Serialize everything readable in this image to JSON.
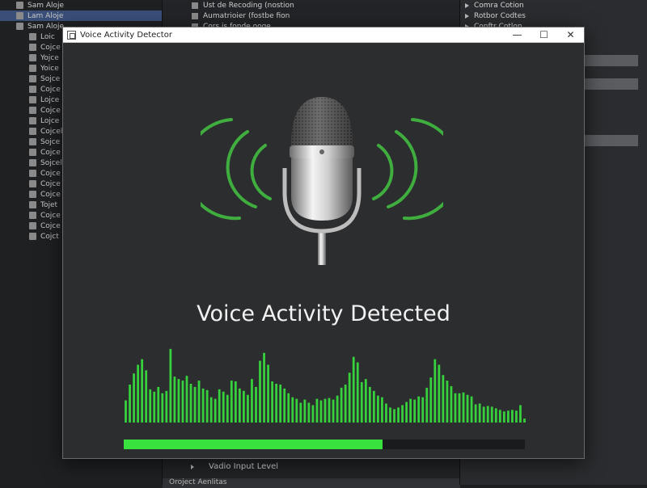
{
  "background": {
    "left_panel": [
      {
        "label": "Sam Aloje",
        "top": true,
        "selected": false
      },
      {
        "label": "Lam Aloje",
        "top": true,
        "selected": true
      },
      {
        "label": "Sam Aloje",
        "top": true,
        "selected": false
      },
      {
        "label": "Loic",
        "selected": false
      },
      {
        "label": "Cojce",
        "selected": false
      },
      {
        "label": "Yojce",
        "selected": false
      },
      {
        "label": "Yoice",
        "selected": false
      },
      {
        "label": "Sojce",
        "selected": false
      },
      {
        "label": "Cojce",
        "selected": false
      },
      {
        "label": "Lojce",
        "selected": false
      },
      {
        "label": "Cojce",
        "selected": false
      },
      {
        "label": "Lojce",
        "selected": false
      },
      {
        "label": "Cojcel",
        "selected": false
      },
      {
        "label": "Sojce",
        "selected": false
      },
      {
        "label": "Cojce",
        "selected": false
      },
      {
        "label": "Sojcel",
        "selected": false
      },
      {
        "label": "Cojce",
        "selected": false
      },
      {
        "label": "Cojce",
        "selected": false
      },
      {
        "label": "Cojce",
        "selected": false
      },
      {
        "label": "Tojet",
        "selected": false
      },
      {
        "label": "Cojce",
        "selected": false
      },
      {
        "label": "Cojce",
        "selected": false
      },
      {
        "label": "Cojct",
        "selected": false
      }
    ],
    "middle_panel": [
      "Ust de Recoding (nostion",
      "Aumatrioier (fostbe fion",
      "Cors is fonde ooge"
    ],
    "middle_bottom_item": "Vadio Input Level",
    "middle_section_header": "Oroject Aenlitas",
    "right_panel": [
      "Comra Cotion",
      "Rotbor Codtes",
      "Conftr Cotlon"
    ]
  },
  "window": {
    "title": "Voice Activity Detector",
    "minimize_label": "—",
    "maximize_label": "☐",
    "close_label": "✕",
    "status_text": "Voice Activity Detected",
    "input_level": 0.645,
    "accent_color": "#39e13f",
    "waveform_color": "#36d13c",
    "waveform": [
      0.28,
      0.48,
      0.62,
      0.73,
      0.8,
      0.66,
      0.42,
      0.39,
      0.45,
      0.37,
      0.4,
      0.93,
      0.58,
      0.55,
      0.53,
      0.59,
      0.49,
      0.45,
      0.53,
      0.43,
      0.41,
      0.32,
      0.3,
      0.42,
      0.39,
      0.35,
      0.53,
      0.52,
      0.43,
      0.4,
      0.35,
      0.55,
      0.45,
      0.78,
      0.88,
      0.73,
      0.52,
      0.49,
      0.48,
      0.43,
      0.37,
      0.32,
      0.3,
      0.25,
      0.29,
      0.25,
      0.22,
      0.3,
      0.28,
      0.3,
      0.31,
      0.29,
      0.34,
      0.44,
      0.48,
      0.63,
      0.83,
      0.76,
      0.51,
      0.55,
      0.45,
      0.4,
      0.34,
      0.32,
      0.24,
      0.19,
      0.17,
      0.19,
      0.22,
      0.26,
      0.3,
      0.29,
      0.33,
      0.32,
      0.44,
      0.57,
      0.8,
      0.73,
      0.6,
      0.53,
      0.46,
      0.37,
      0.37,
      0.38,
      0.35,
      0.33,
      0.23,
      0.24,
      0.2,
      0.21,
      0.2,
      0.18,
      0.16,
      0.14,
      0.15,
      0.16,
      0.15,
      0.22,
      0.05
    ]
  }
}
